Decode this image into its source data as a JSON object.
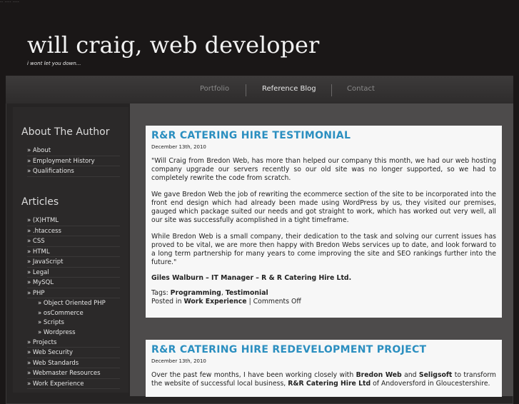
{
  "header": {
    "topline": "-- ---- ----",
    "title": "will craig, web developer",
    "tagline": "i wont let you down..."
  },
  "nav": {
    "items": [
      "Portfolio",
      "Reference Blog",
      "Contact"
    ],
    "active": "Reference Blog"
  },
  "sidebar": {
    "about_heading": "About The Author",
    "about_items": [
      "» About",
      "» Employment History",
      "» Qualifications"
    ],
    "articles_heading": "Articles",
    "articles": [
      "» (X)HTML",
      "» .htaccess",
      "» CSS",
      "» HTML",
      "» JavaScript",
      "» Legal",
      "» MySQL",
      "» PHP",
      "» Object Oriented PHP",
      "» osCommerce",
      "» Scripts",
      "» Wordpress",
      "» Projects",
      "» Web Security",
      "» Web Standards",
      "» Webmaster Resources",
      "» Work Experience"
    ]
  },
  "posts": [
    {
      "title": "R&R CATERING HIRE TESTIMONIAL",
      "date": "December 13th, 2010",
      "p1": "\"Will Craig from Bredon Web, has more than helped our company this month, we had our web hosting company upgrade our servers recently so our old site was no longer supported, so we had to completely rewrite the code from scratch.",
      "p2": "We gave Bredon Web the job of rewriting the ecommerce section of the site to be incorporated into the front end design which had already been made using WordPress by us, they visited our premises, gauged which package suited our needs and got straight to work, which has worked out very well, all our site was successfully acomplished in a tight timeframe.",
      "p3": "While Bredon Web is a small company, their dedication to the task and solving our current issues has proved to be vital, we are more then happy with Bredon Webs services up to date, and look forward to a long term partnership for many years to come improving the site and SEO rankings further into the future.\"",
      "signature": "Giles Walburn – IT Manager – R & R Catering Hire Ltd.",
      "tags_label": "Tags: ",
      "tag1": "Programming",
      "tag_sep": ", ",
      "tag2": "Testimonial",
      "posted_label": "Posted in ",
      "category": "Work Experience",
      "comments": " | Comments Off"
    },
    {
      "title": "R&R CATERING HIRE REDEVELOPMENT PROJECT",
      "date": "December 13th, 2010",
      "t1": "Over the past few months, I have been working closely with ",
      "b1": "Bredon Web",
      "t2": " and ",
      "b2": "Seligsoft",
      "t3": " to transform the website of successful local business, ",
      "b3": "R&R Catering Hire Ltd",
      "t4": " of Andoversford in Gloucestershire."
    }
  ]
}
